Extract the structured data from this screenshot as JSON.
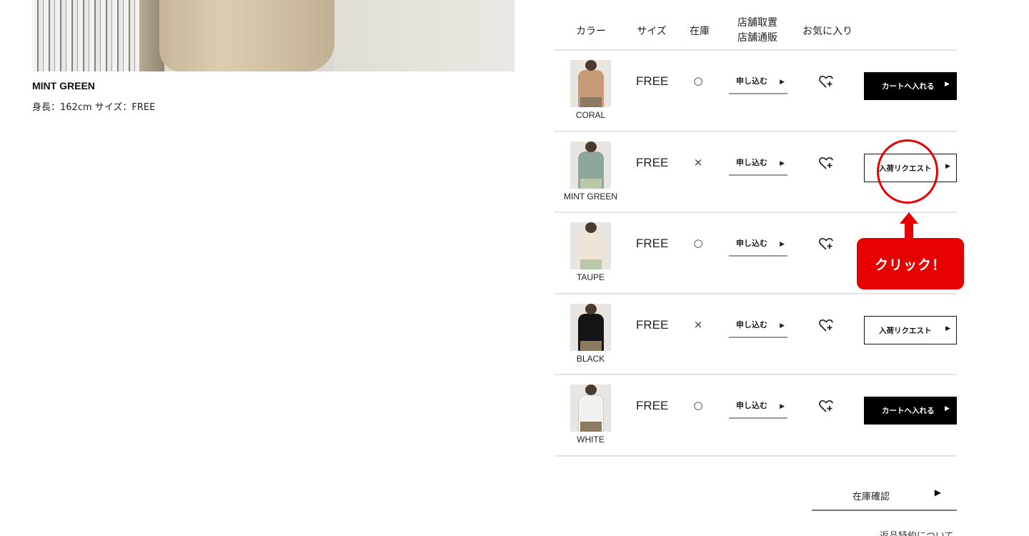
{
  "left": {
    "caption": "MINT GREEN",
    "meta": "身長：162cm サイズ：FREE"
  },
  "table": {
    "headers": {
      "color": "カラー",
      "size": "サイズ",
      "stock": "在庫",
      "store_line1": "店舗取置",
      "store_line2": "店舗通販",
      "favorite": "お気に入り"
    },
    "rows": [
      {
        "color": "CORAL",
        "size": "FREE",
        "stock": "○",
        "apply": "申し込む",
        "action": "カートへ入れる",
        "action_type": "cart",
        "swatch": "#c79a78"
      },
      {
        "color": "MINT GREEN",
        "size": "FREE",
        "stock": "×",
        "apply": "申し込む",
        "action": "入荷リクエスト",
        "action_type": "request",
        "swatch": "#8fa79b"
      },
      {
        "color": "TAUPE",
        "size": "FREE",
        "stock": "○",
        "apply": "申し込む",
        "action": "",
        "action_type": "none",
        "swatch": "#ece5d8"
      },
      {
        "color": "BLACK",
        "size": "FREE",
        "stock": "×",
        "apply": "申し込む",
        "action": "入荷リクエスト",
        "action_type": "request",
        "swatch": "#141414"
      },
      {
        "color": "WHITE",
        "size": "FREE",
        "stock": "○",
        "apply": "申し込む",
        "action": "カートへ入れる",
        "action_type": "cart",
        "swatch": "#f1f1ef"
      }
    ],
    "arrow_glyph": "▶"
  },
  "annotation": {
    "callout": "クリック！",
    "color": "#e60000"
  },
  "bottom": {
    "stock_check": "在庫確認",
    "returns": "返品特約について"
  },
  "icons": {
    "heart": "heart-plus-icon",
    "arrow": "triangle-right-icon"
  }
}
